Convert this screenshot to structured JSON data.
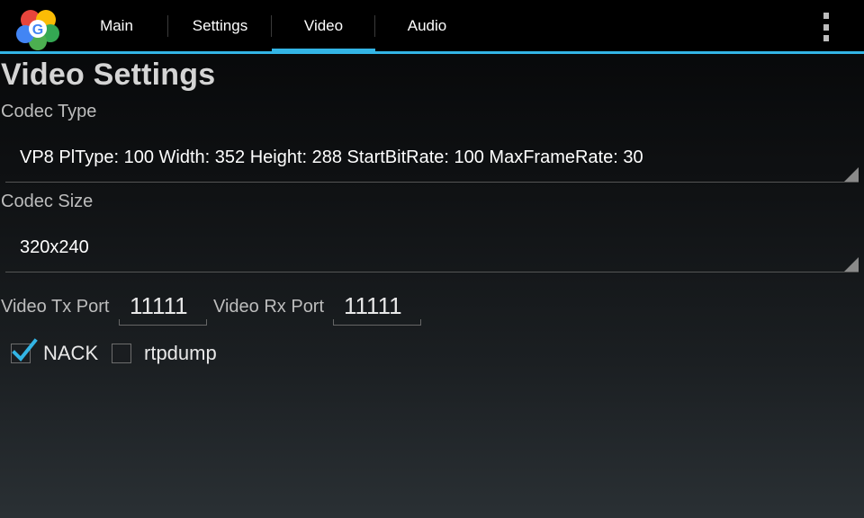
{
  "app": {
    "logo_icon": "webrtc-logo-icon"
  },
  "tabs": [
    {
      "label": "Main",
      "active": false
    },
    {
      "label": "Settings",
      "active": false
    },
    {
      "label": "Video",
      "active": true
    },
    {
      "label": "Audio",
      "active": false
    }
  ],
  "overflow_icon": "overflow-menu-icon",
  "colors": {
    "accent": "#33b5e5",
    "background_top": "#050607",
    "background_bottom": "#2a3034"
  },
  "page": {
    "title": "Video Settings"
  },
  "codec_type": {
    "label": "Codec Type",
    "selected": "VP8 PlType: 100 Width: 352 Height: 288 StartBitRate: 100 MaxFrameRate: 30"
  },
  "codec_size": {
    "label": "Codec Size",
    "selected": "320x240"
  },
  "ports": {
    "tx_label": "Video Tx Port",
    "tx_value": "11111",
    "rx_label": "Video Rx Port",
    "rx_value": "11111"
  },
  "options": {
    "nack": {
      "label": "NACK",
      "checked": true
    },
    "rtpdump": {
      "label": "rtpdump",
      "checked": false
    }
  }
}
